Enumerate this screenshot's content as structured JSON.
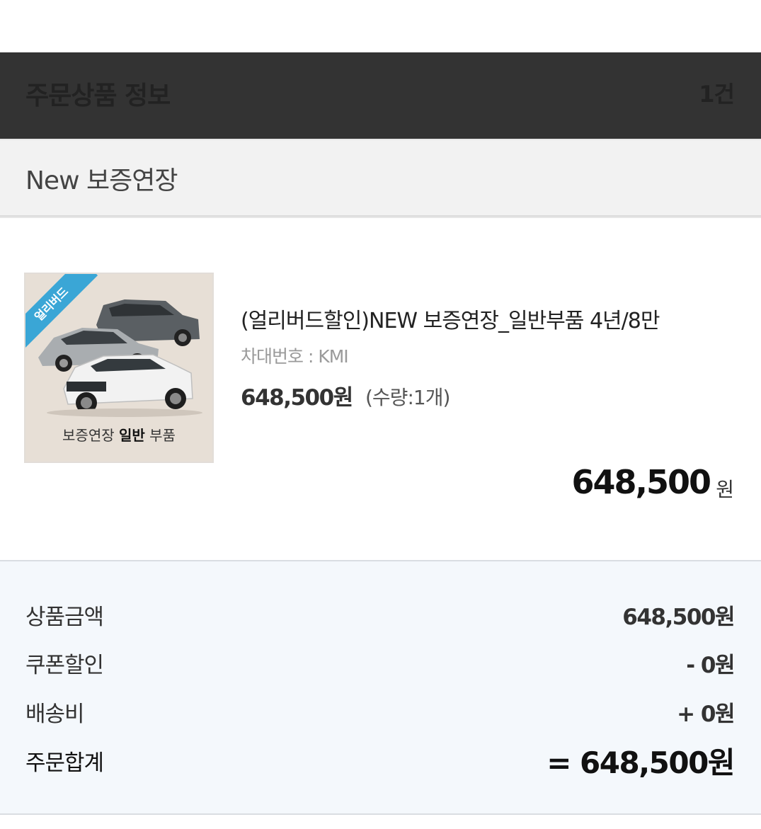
{
  "header": {
    "title": "주문상품 정보",
    "count": "1건"
  },
  "category": {
    "title": "New 보증연장"
  },
  "product": {
    "image": {
      "badge": "얼리버드",
      "caption_prefix": "보증연장",
      "caption_bold": "일반",
      "caption_suffix": "부품"
    },
    "name": "(얼리버드할인)NEW 보증연장_일반부품 4년/8만",
    "vin": "차대번호 : KMI",
    "unit_price": "648,500원",
    "quantity": "(수량:1개)",
    "total_amount": "648,500",
    "total_unit": "원"
  },
  "summary": {
    "rows": [
      {
        "label": "상품금액",
        "value": "648,500원"
      },
      {
        "label": "쿠폰할인",
        "value": "- 0원"
      },
      {
        "label": "배송비",
        "value": "+ 0원"
      },
      {
        "label": "주문합계",
        "value": "= 648,500원"
      }
    ]
  },
  "colors": {
    "header_bg": "#333333",
    "summary_bg": "#f4f8fc",
    "badge": "#3aa6d6"
  }
}
